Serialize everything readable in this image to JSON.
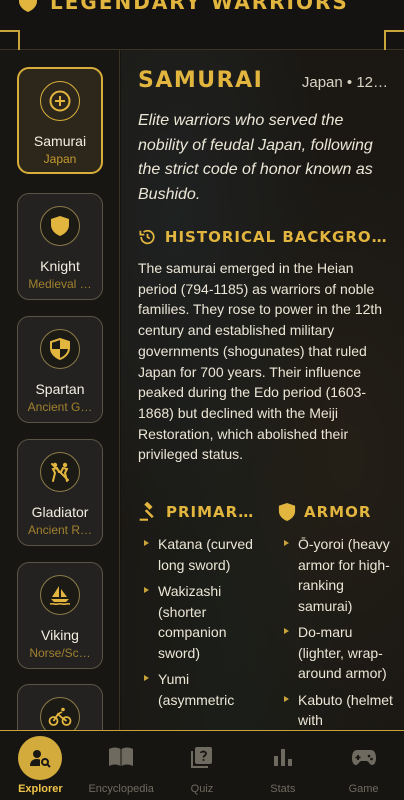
{
  "app": {
    "title": "LEGENDARY WARRIORS"
  },
  "theme": {
    "accent": "#e2b53f",
    "background": "#151412",
    "muted": "#6f6a5f"
  },
  "sidebar": {
    "items": [
      {
        "name": "Samurai",
        "origin": "Japan",
        "icon": "plus-circle-icon",
        "active": true
      },
      {
        "name": "Knight",
        "origin": "Medieval …",
        "icon": "shield-icon",
        "active": false
      },
      {
        "name": "Spartan",
        "origin": "Ancient G…",
        "icon": "half-shield-icon",
        "active": false
      },
      {
        "name": "Gladiator",
        "origin": "Ancient R…",
        "icon": "fencing-icon",
        "active": false
      },
      {
        "name": "Viking",
        "origin": "Norse/Sc…",
        "icon": "sailboat-icon",
        "active": false
      },
      {
        "name": "",
        "origin": "",
        "icon": "bicycle-icon",
        "active": false
      }
    ]
  },
  "detail": {
    "name": "SAMURAI",
    "meta": "Japan • 12…",
    "tagline": "Elite warriors who served the nobility of feudal Japan, following the strict code of honor known as Bushido.",
    "history_title": "HISTORICAL BACKGROU…",
    "history_text": "The samurai emerged in the Heian period (794-1185) as warriors of noble families. They rose to power in the 12th century and established military governments (shogunates) that ruled Japan for 700 years. Their influence peaked during the Edo period (1603-1868) but declined with the Meiji Restoration, which abolished their privileged status.",
    "weapons_title": "PRIMAR…",
    "weapons": [
      "Katana (curved long sword)",
      "Wakizashi (shorter companion sword)",
      "Yumi (asymmetric"
    ],
    "armor_title": "ARMOR",
    "armor": [
      "Ō-yoroi (heavy armor for high-ranking samurai)",
      "Do-maru (lighter, wrap-around armor)",
      "Kabuto (helmet with"
    ]
  },
  "nav": {
    "items": [
      {
        "label": "Explorer",
        "icon": "person-search-icon",
        "active": true
      },
      {
        "label": "Encyclopedia",
        "icon": "open-book-icon",
        "active": false
      },
      {
        "label": "Quiz",
        "icon": "quiz-icon",
        "active": false
      },
      {
        "label": "Stats",
        "icon": "bar-chart-icon",
        "active": false
      },
      {
        "label": "Game",
        "icon": "gamepad-icon",
        "active": false
      }
    ]
  }
}
